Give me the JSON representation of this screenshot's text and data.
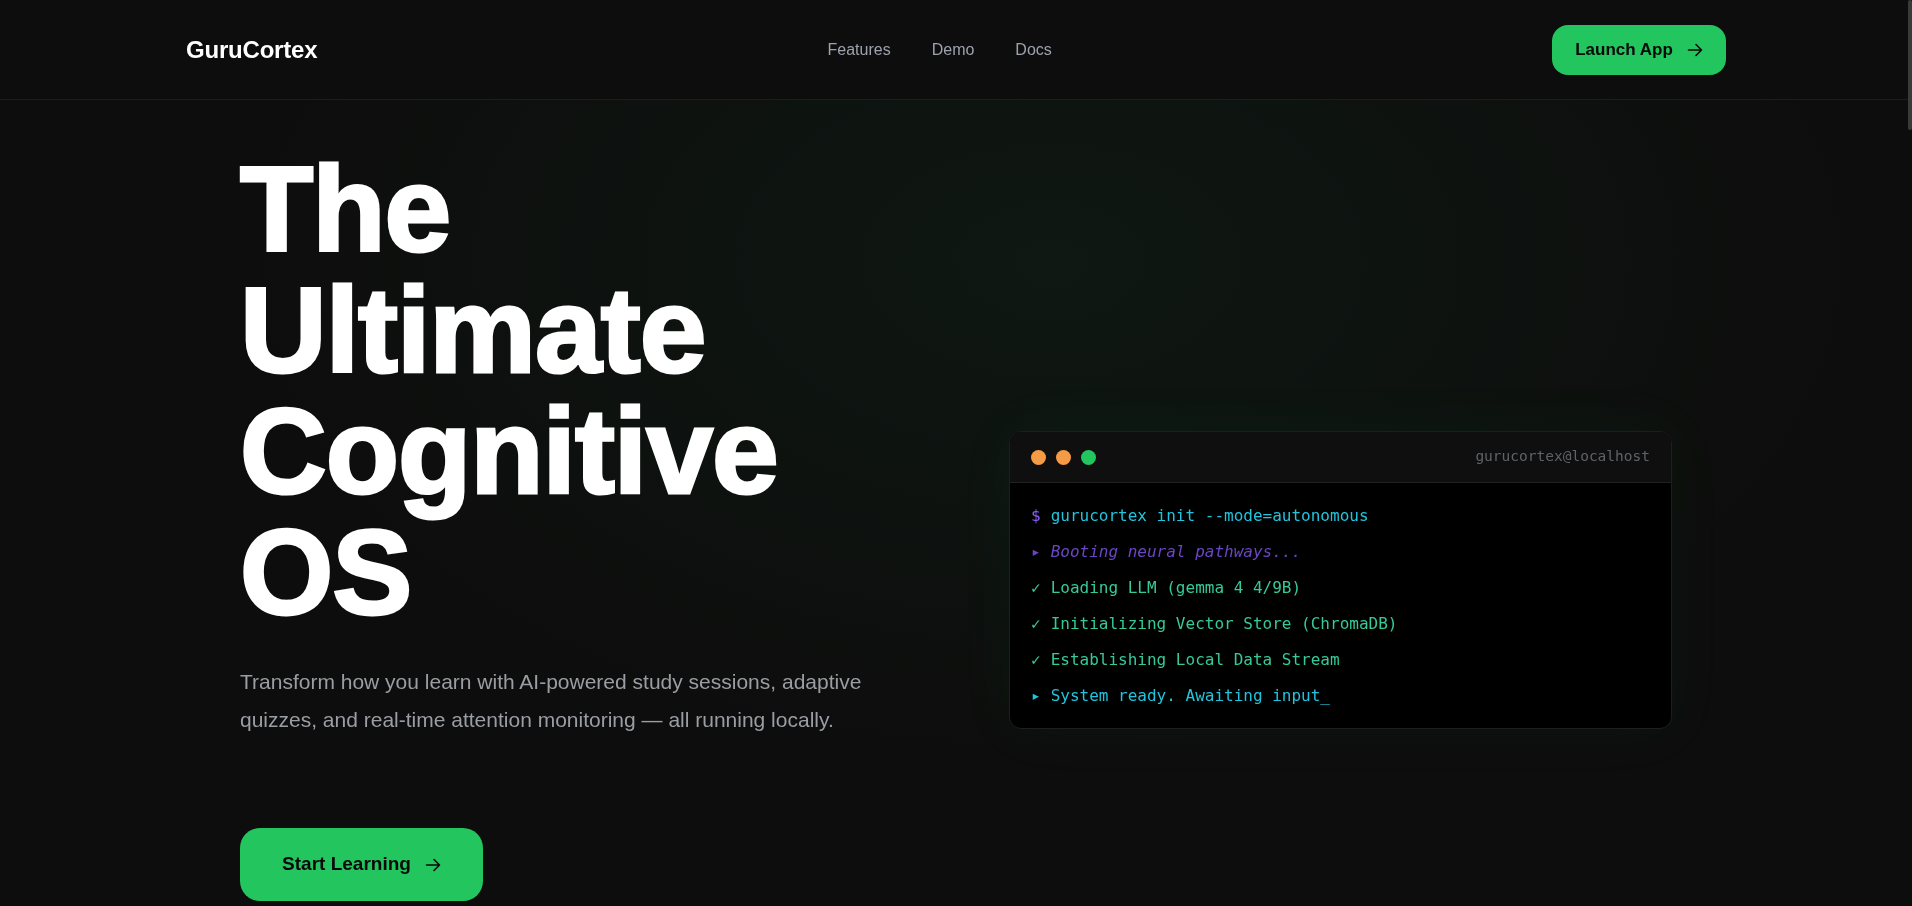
{
  "header": {
    "logo": "GuruCortex",
    "nav": [
      {
        "label": "Features"
      },
      {
        "label": "Demo"
      },
      {
        "label": "Docs"
      }
    ],
    "cta": {
      "label": "Launch App"
    }
  },
  "hero": {
    "title": "The Ultimate Cognitive OS",
    "subtitle": "Transform how you learn with AI-powered study sessions, adaptive quizzes, and real-time attention monitoring — all running locally.",
    "cta": {
      "label": "Start Learning"
    }
  },
  "terminal": {
    "dots": [
      {
        "color": "#f59a45"
      },
      {
        "color": "#f59a45"
      },
      {
        "color": "#22c55e"
      }
    ],
    "host": "gurucortex@localhost",
    "lines": [
      {
        "kind": "command",
        "prefix": "$",
        "text": "gurucortex init --mode=autonomous"
      },
      {
        "kind": "info",
        "prefix": "▸",
        "text": "Booting neural pathways..."
      },
      {
        "kind": "success",
        "prefix": "✓",
        "text": "Loading LLM (gemma 4 4/9B)"
      },
      {
        "kind": "success",
        "prefix": "✓",
        "text": "Initializing Vector Store (ChromaDB)"
      },
      {
        "kind": "success",
        "prefix": "✓",
        "text": "Establishing Local Data Stream"
      },
      {
        "kind": "ready",
        "prefix": "▸",
        "text": "System ready. Awaiting input_"
      }
    ]
  }
}
